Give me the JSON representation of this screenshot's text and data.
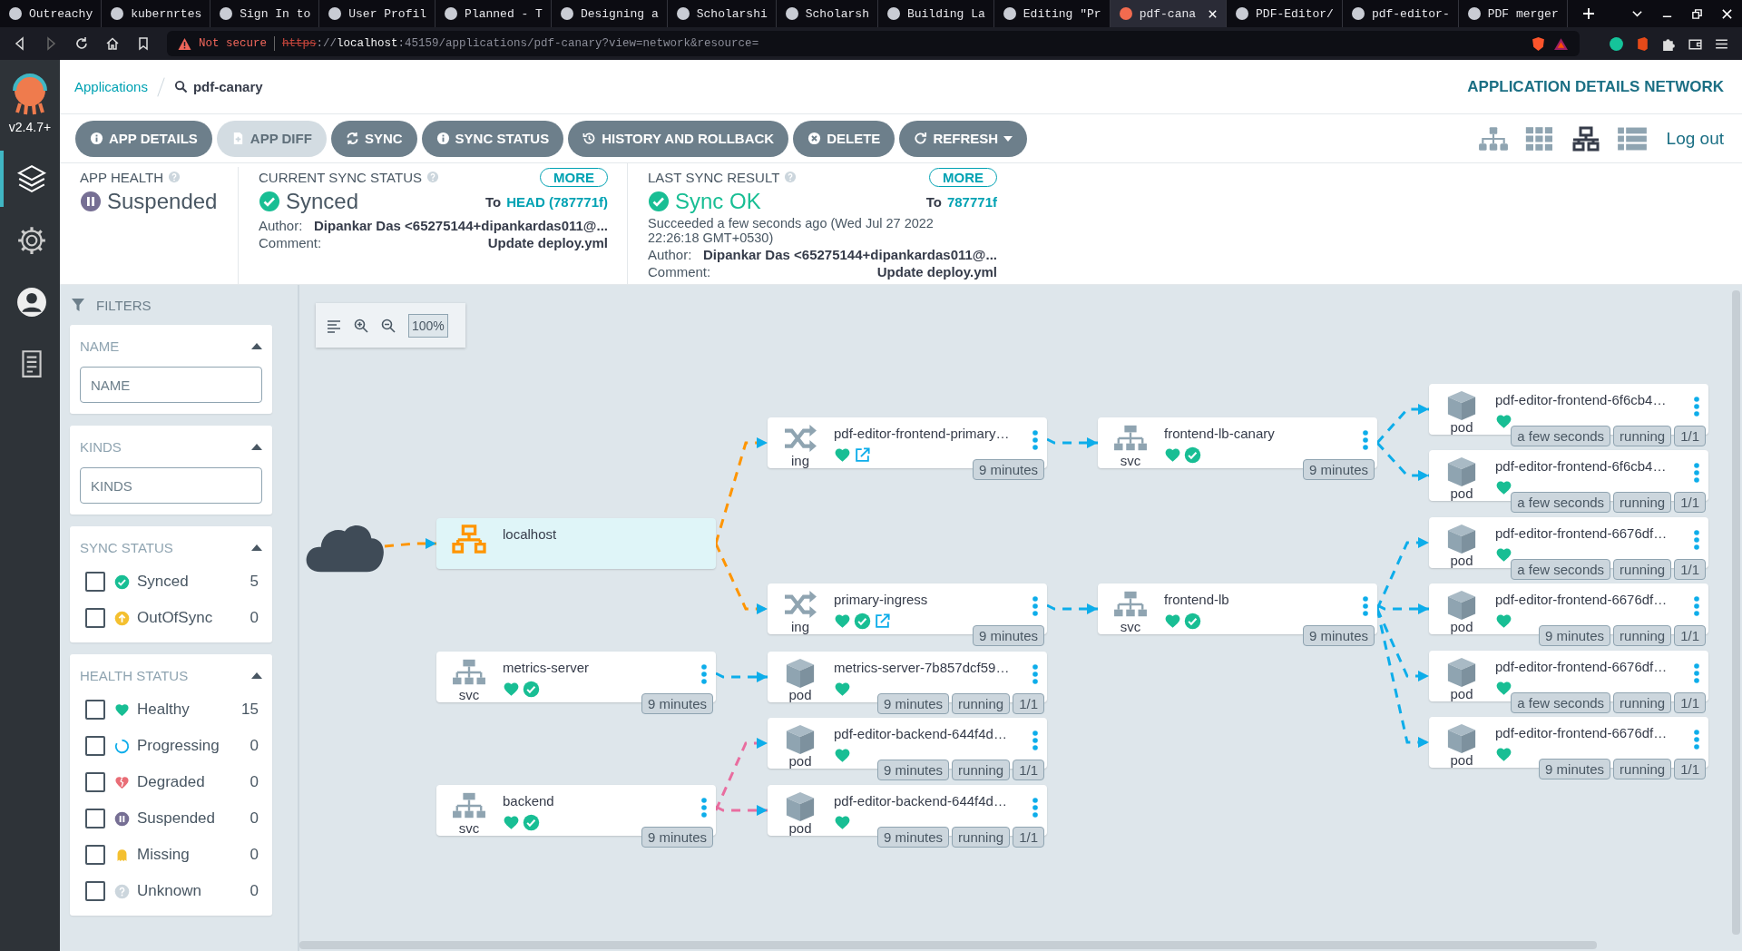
{
  "browser": {
    "tabs": [
      {
        "title": "Outreachy",
        "selected": false
      },
      {
        "title": "kubernrtes",
        "selected": false
      },
      {
        "title": "Sign In to",
        "selected": false
      },
      {
        "title": "User Profil",
        "selected": false
      },
      {
        "title": "Planned - T",
        "selected": false
      },
      {
        "title": "Designing a",
        "selected": false
      },
      {
        "title": "Scholarshi",
        "selected": false
      },
      {
        "title": "Scholarsh",
        "selected": false
      },
      {
        "title": "Building La",
        "selected": false
      },
      {
        "title": "Editing \"Pr",
        "selected": false
      },
      {
        "title": "pdf-cana",
        "selected": true
      },
      {
        "title": "PDF-Editor/",
        "selected": false
      },
      {
        "title": "pdf-editor-",
        "selected": false
      },
      {
        "title": "PDF merger",
        "selected": false
      }
    ],
    "security": "Not secure",
    "url": [
      {
        "text": "https",
        "kind": "insecure-scheme"
      },
      {
        "text": "://",
        "kind": "dim"
      },
      {
        "text": "localhost",
        "kind": "host"
      },
      {
        "text": ":45159/applications/pdf-canary?view=network&resource=",
        "kind": "dim"
      }
    ]
  },
  "sidebar": {
    "version": "v2.4.7+",
    "items": [
      {
        "kind": "applications",
        "selected": true
      },
      {
        "kind": "settings",
        "selected": false
      },
      {
        "kind": "user",
        "selected": false
      },
      {
        "kind": "docs",
        "selected": false
      }
    ]
  },
  "breadcrumb": {
    "root": "Applications",
    "current": "pdf-canary"
  },
  "page_title": "APPLICATION DETAILS NETWORK",
  "toolbar": [
    {
      "label": "APP DETAILS",
      "kind": "info",
      "disabled": false
    },
    {
      "label": "APP DIFF",
      "kind": "diff",
      "disabled": true
    },
    {
      "label": "SYNC",
      "kind": "sync",
      "disabled": false
    },
    {
      "label": "SYNC STATUS",
      "kind": "info",
      "disabled": false
    },
    {
      "label": "HISTORY AND ROLLBACK",
      "kind": "history",
      "disabled": false
    },
    {
      "label": "DELETE",
      "kind": "delete",
      "disabled": false
    },
    {
      "label": "REFRESH",
      "kind": "refresh",
      "disabled": false,
      "dropdown": true
    }
  ],
  "view_modes": [
    {
      "kind": "tree",
      "selected": false
    },
    {
      "kind": "pods",
      "selected": false
    },
    {
      "kind": "network",
      "selected": true
    },
    {
      "kind": "list",
      "selected": false
    }
  ],
  "logout": "Log out",
  "summary": {
    "app_health": {
      "title": "APP HEALTH",
      "kind": "suspended",
      "value": "Suspended"
    },
    "current_sync": {
      "title": "CURRENT SYNC STATUS",
      "more": "MORE",
      "kind": "synced",
      "value": "Synced",
      "to_prefix": "To",
      "revision": "HEAD (787771f)",
      "author_label": "Author:",
      "author": "Dipankar Das <65275144+dipankardas011@...",
      "comment_label": "Comment:",
      "comment": "Update deploy.yml"
    },
    "last_sync": {
      "title": "LAST SYNC RESULT",
      "more": "MORE",
      "kind": "synced",
      "value": "Sync OK",
      "to_prefix": "To",
      "revision": "787771f",
      "detail": "Succeeded a few seconds ago (Wed Jul 27 2022 22:26:18 GMT+0530)",
      "author_label": "Author:",
      "author": "Dipankar Das <65275144+dipankardas011@...",
      "comment_label": "Comment:",
      "comment": "Update deploy.yml"
    }
  },
  "filters": {
    "title": "FILTERS",
    "sections": [
      {
        "title": "NAME",
        "expanded": true,
        "kind": "text",
        "placeholder": "NAME"
      },
      {
        "title": "KINDS",
        "expanded": true,
        "kind": "text",
        "placeholder": "KINDS"
      },
      {
        "title": "SYNC STATUS",
        "expanded": true,
        "kind": "checklist",
        "options": [
          {
            "label": "Synced",
            "kind": "synced",
            "count": "5",
            "checked": false
          },
          {
            "label": "OutOfSync",
            "kind": "outofsync",
            "count": "0",
            "checked": false
          }
        ]
      },
      {
        "title": "HEALTH STATUS",
        "expanded": true,
        "kind": "checklist",
        "options": [
          {
            "label": "Healthy",
            "kind": "healthy",
            "count": "15",
            "checked": false
          },
          {
            "label": "Progressing",
            "kind": "progressing",
            "count": "0",
            "checked": false
          },
          {
            "label": "Degraded",
            "kind": "degraded",
            "count": "0",
            "checked": false
          },
          {
            "label": "Suspended",
            "kind": "suspended",
            "count": "0",
            "checked": false
          },
          {
            "label": "Missing",
            "kind": "missing",
            "count": "0",
            "checked": false
          },
          {
            "label": "Unknown",
            "kind": "unknown",
            "count": "0",
            "checked": false
          }
        ]
      }
    ]
  },
  "graph": {
    "zoom": "100%",
    "nodes": [
      {
        "kind": "internet"
      },
      {
        "kind": "load-balancer",
        "name": "localhost"
      },
      {
        "kind": "svc",
        "label": "svc",
        "name": "metrics-server",
        "status_icons": [
          {
            "kind": "health"
          },
          {
            "kind": "sync"
          }
        ],
        "menu": true,
        "badges": [
          "9 minutes"
        ]
      },
      {
        "kind": "svc",
        "label": "svc",
        "name": "backend",
        "status_icons": [
          {
            "kind": "health"
          },
          {
            "kind": "sync"
          }
        ],
        "menu": true,
        "badges": [
          "9 minutes"
        ]
      },
      {
        "kind": "ing",
        "label": "ing",
        "name": "pdf-editor-frontend-primary…",
        "status_icons": [
          {
            "kind": "health"
          },
          {
            "kind": "link"
          }
        ],
        "menu": true,
        "badges": [
          "9 minutes"
        ]
      },
      {
        "kind": "ing",
        "label": "ing",
        "name": "primary-ingress",
        "status_icons": [
          {
            "kind": "health"
          },
          {
            "kind": "sync"
          },
          {
            "kind": "link"
          }
        ],
        "menu": true,
        "badges": [
          "9 minutes"
        ]
      },
      {
        "kind": "pod",
        "label": "pod",
        "name": "metrics-server-7b857dcf59…",
        "status_icons": [
          {
            "kind": "health"
          }
        ],
        "menu": true,
        "badges": [
          "9 minutes",
          "running",
          "1/1"
        ]
      },
      {
        "kind": "pod",
        "label": "pod",
        "name": "pdf-editor-backend-644f4d…",
        "status_icons": [
          {
            "kind": "health"
          }
        ],
        "menu": true,
        "badges": [
          "9 minutes",
          "running",
          "1/1"
        ]
      },
      {
        "kind": "pod",
        "label": "pod",
        "name": "pdf-editor-backend-644f4d…",
        "status_icons": [
          {
            "kind": "health"
          }
        ],
        "menu": true,
        "badges": [
          "9 minutes",
          "running",
          "1/1"
        ]
      },
      {
        "kind": "svc",
        "label": "svc",
        "name": "frontend-lb-canary",
        "status_icons": [
          {
            "kind": "health"
          },
          {
            "kind": "sync"
          }
        ],
        "menu": true,
        "badges": [
          "9 minutes"
        ]
      },
      {
        "kind": "svc",
        "label": "svc",
        "name": "frontend-lb",
        "status_icons": [
          {
            "kind": "health"
          },
          {
            "kind": "sync"
          }
        ],
        "menu": true,
        "badges": [
          "9 minutes"
        ]
      },
      {
        "kind": "pod",
        "label": "pod",
        "name": "pdf-editor-frontend-6f6cb4…",
        "status_icons": [
          {
            "kind": "health"
          }
        ],
        "menu": true,
        "badges": [
          "a few seconds",
          "running",
          "1/1"
        ]
      },
      {
        "kind": "pod",
        "label": "pod",
        "name": "pdf-editor-frontend-6f6cb4…",
        "status_icons": [
          {
            "kind": "health"
          }
        ],
        "menu": true,
        "badges": [
          "a few seconds",
          "running",
          "1/1"
        ]
      },
      {
        "kind": "pod",
        "label": "pod",
        "name": "pdf-editor-frontend-6676df…",
        "status_icons": [
          {
            "kind": "health"
          }
        ],
        "menu": true,
        "badges": [
          "a few seconds",
          "running",
          "1/1"
        ]
      },
      {
        "kind": "pod",
        "label": "pod",
        "name": "pdf-editor-frontend-6676df…",
        "status_icons": [
          {
            "kind": "health"
          }
        ],
        "menu": true,
        "badges": [
          "9 minutes",
          "running",
          "1/1"
        ]
      },
      {
        "kind": "pod",
        "label": "pod",
        "name": "pdf-editor-frontend-6676df…",
        "status_icons": [
          {
            "kind": "health"
          }
        ],
        "menu": true,
        "badges": [
          "a few seconds",
          "running",
          "1/1"
        ]
      },
      {
        "kind": "pod",
        "label": "pod",
        "name": "pdf-editor-frontend-6676df…",
        "status_icons": [
          {
            "kind": "health"
          }
        ],
        "menu": true,
        "badges": [
          "9 minutes",
          "running",
          "1/1"
        ]
      }
    ],
    "edges": [
      {
        "color": "#ff9500"
      },
      {
        "color": "#ff9500"
      },
      {
        "color": "#ff9500"
      },
      {
        "color": "#0dadea"
      },
      {
        "color": "#e96d9f"
      },
      {
        "color": "#e96d9f"
      },
      {
        "color": "#0dadea"
      },
      {
        "color": "#0dadea"
      },
      {
        "color": "#0dadea"
      },
      {
        "color": "#0dadea"
      },
      {
        "color": "#0dadea"
      },
      {
        "color": "#0dadea"
      },
      {
        "color": "#0dadea"
      },
      {
        "color": "#0dadea"
      }
    ]
  }
}
